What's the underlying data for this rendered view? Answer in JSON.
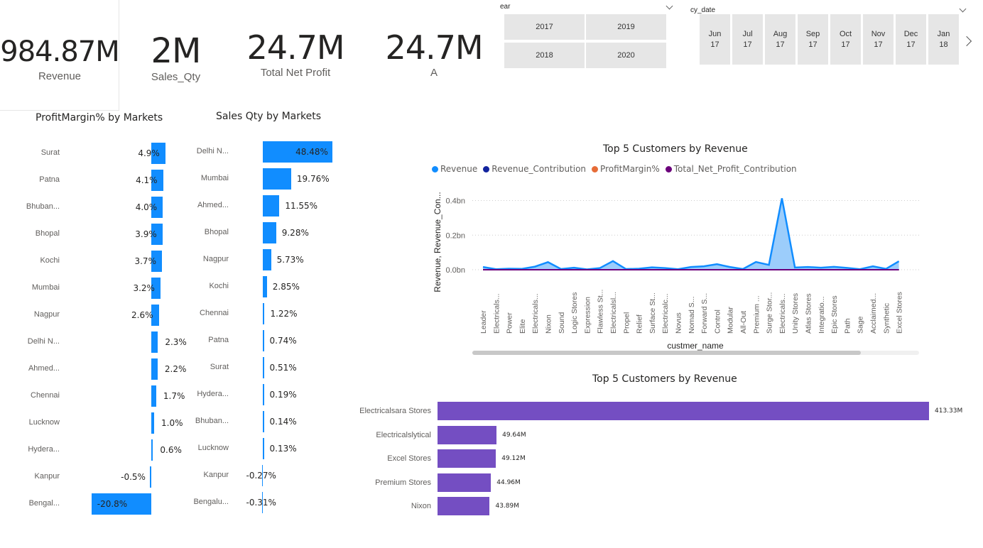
{
  "kpis": [
    {
      "value": "984.87M",
      "label": "Revenue"
    },
    {
      "value": "2M",
      "label": "Sales_Qty"
    },
    {
      "value": "24.7M",
      "label": "Total Net Profit"
    },
    {
      "value": "24.7M",
      "label": "A"
    }
  ],
  "year_slicer": {
    "title": "ear",
    "options": [
      "2017",
      "2019",
      "2018",
      "2020"
    ]
  },
  "date_slicer": {
    "title": "cy_date",
    "options": [
      {
        "month": "Jun",
        "year": "17"
      },
      {
        "month": "Jul",
        "year": "17"
      },
      {
        "month": "Aug",
        "year": "17"
      },
      {
        "month": "Sep",
        "year": "17"
      },
      {
        "month": "Oct",
        "year": "17"
      },
      {
        "month": "Nov",
        "year": "17"
      },
      {
        "month": "Dec",
        "year": "17"
      },
      {
        "month": "Jan",
        "year": "18"
      }
    ]
  },
  "colors": {
    "bar_blue": "#118dff",
    "bar_purple": "#744ec2",
    "line_blue": "#118dff",
    "dark_blue": "#12239e",
    "orange": "#e66c37",
    "purple": "#6b007b"
  },
  "chart_data": [
    {
      "type": "bar",
      "orientation": "horizontal",
      "title": "ProfitMargin% by Markets",
      "categories": [
        "Surat",
        "Patna",
        "Bhuban...",
        "Bhopal",
        "Kochi",
        "Mumbai",
        "Nagpur",
        "Delhi N...",
        "Ahmed...",
        "Chennai",
        "Lucknow",
        "Hydera...",
        "Kanpur",
        "Bengal..."
      ],
      "values": [
        4.9,
        4.1,
        4.0,
        3.9,
        3.7,
        3.2,
        2.6,
        2.3,
        2.2,
        1.7,
        1.0,
        0.6,
        -0.5,
        -20.8
      ],
      "labels": [
        "4.9%",
        "4.1%",
        "4.0%",
        "3.9%",
        "3.7%",
        "3.2%",
        "2.6%",
        "2.3%",
        "2.2%",
        "1.7%",
        "1.0%",
        "0.6%",
        "-0.5%",
        "-20.8%"
      ]
    },
    {
      "type": "bar",
      "orientation": "horizontal",
      "title": "Sales Qty by Markets",
      "categories": [
        "Delhi N...",
        "Mumbai",
        "Ahmed...",
        "Bhopal",
        "Nagpur",
        "Kochi",
        "Chennai",
        "Patna",
        "Surat",
        "Hydera...",
        "Bhuban...",
        "Lucknow",
        "Kanpur",
        "Bengalu..."
      ],
      "values": [
        48.48,
        19.76,
        11.55,
        9.28,
        5.73,
        2.85,
        1.22,
        0.74,
        0.51,
        0.19,
        0.14,
        0.13,
        -0.27,
        -0.31
      ],
      "labels": [
        "48.48%",
        "19.76%",
        "11.55%",
        "9.28%",
        "5.73%",
        "2.85%",
        "1.22%",
        "0.74%",
        "0.51%",
        "0.19%",
        "0.14%",
        "0.13%",
        "-0.27%",
        "-0.31%"
      ]
    },
    {
      "type": "area",
      "title": "Top 5 Customers by Revenue",
      "xlabel": "custmer_name",
      "ylabel": "Revenue, Revenue_Con...",
      "ylim": [
        0,
        0.45
      ],
      "yticks": [
        "0.0bn",
        "0.2bn",
        "0.4bn"
      ],
      "grid": true,
      "categories": [
        "Leader",
        "Electricals...",
        "Power",
        "Elite",
        "Electricals...",
        "Nixon",
        "Sound",
        "Logic Stores",
        "Expression",
        "Flawless St...",
        "Electricalsl...",
        "Propel",
        "Relief",
        "Surface St...",
        "Electricalc...",
        "Novus",
        "Nomad S...",
        "Forward S...",
        "Control",
        "Modular",
        "All-Out",
        "Premium ...",
        "Surge Stor...",
        "Electricals...",
        "Unity Stores",
        "Atlas Stores",
        "Integratio...",
        "Epic Stores",
        "Path",
        "Sage",
        "Acclaimed...",
        "Synthetic",
        "Excel Stores"
      ],
      "series": [
        {
          "name": "Revenue",
          "values": [
            0.016,
            0.003,
            0.006,
            0.005,
            0.018,
            0.044,
            0.004,
            0.012,
            0.002,
            0.01,
            0.05,
            0.004,
            0.006,
            0.014,
            0.01,
            0.003,
            0.016,
            0.02,
            0.032,
            0.016,
            0.004,
            0.045,
            0.028,
            0.413,
            0.013,
            0.016,
            0.012,
            0.017,
            0.011,
            0.003,
            0.02,
            0.005,
            0.049
          ]
        },
        {
          "name": "Revenue_Contribution",
          "values": [
            0,
            0,
            0,
            0,
            0,
            0,
            0,
            0,
            0,
            0,
            0,
            0,
            0,
            0,
            0,
            0,
            0,
            0,
            0,
            0,
            0,
            0,
            0,
            0,
            0,
            0,
            0,
            0,
            0,
            0,
            0,
            0,
            0
          ]
        },
        {
          "name": "ProfitMargin%",
          "values": [
            0,
            0,
            0,
            0,
            0,
            0,
            0,
            0,
            0,
            0,
            0,
            0,
            0,
            0,
            0,
            0,
            0,
            0,
            0,
            0,
            0,
            0,
            0,
            0,
            0,
            0,
            0,
            0,
            0,
            0,
            0,
            0,
            0
          ]
        },
        {
          "name": "Total_Net_Profit_Contribution",
          "values": [
            0,
            0,
            0,
            0,
            0,
            0,
            0,
            0,
            0,
            0,
            0,
            0,
            0,
            0,
            0,
            0,
            0,
            0,
            0,
            0,
            0,
            0,
            0,
            0,
            0,
            0,
            0,
            0,
            0,
            0,
            0,
            0,
            0
          ]
        }
      ],
      "legend_position": "top-left",
      "scroll_position": 0.87
    },
    {
      "type": "bar",
      "orientation": "horizontal",
      "title": "Top 5 Customers by Revenue",
      "categories": [
        "Electricalsara Stores",
        "Electricalslytical",
        "Excel Stores",
        "Premium Stores",
        "Nixon"
      ],
      "values": [
        413.33,
        49.64,
        49.12,
        44.96,
        43.89
      ],
      "labels": [
        "413.33M",
        "49.64M",
        "49.12M",
        "44.96M",
        "43.89M"
      ]
    }
  ]
}
